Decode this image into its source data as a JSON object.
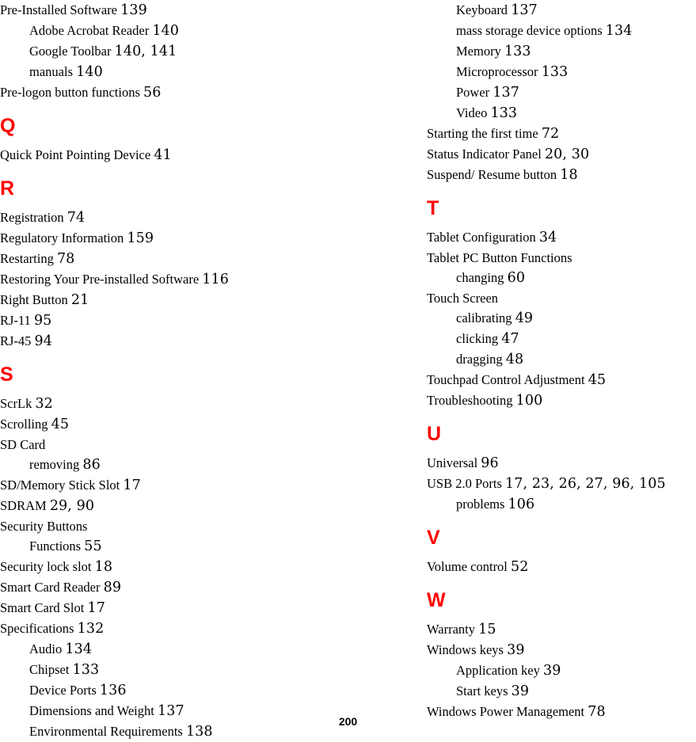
{
  "document": {
    "type": "book-index",
    "folio": "200",
    "accent_color": "#ff0000",
    "text_color": "#000000",
    "background_color": "#ffffff"
  },
  "columns": [
    {
      "name": "left-column",
      "blocks": [
        {
          "heading": null,
          "entries": [
            {
              "level": 1,
              "term": "Pre-Installed Software",
              "pages": "139"
            },
            {
              "level": 2,
              "term": "Adobe Acrobat Reader",
              "pages": "140"
            },
            {
              "level": 2,
              "term": "Google Toolbar",
              "pages": "140, 141"
            },
            {
              "level": 2,
              "term": "manuals",
              "pages": "140"
            },
            {
              "level": 1,
              "term": "Pre-logon button functions",
              "pages": "56"
            }
          ]
        },
        {
          "heading": "Q",
          "entries": [
            {
              "level": 1,
              "term": "Quick Point Pointing Device",
              "pages": "41"
            }
          ]
        },
        {
          "heading": "R",
          "entries": [
            {
              "level": 1,
              "term": "Registration",
              "pages": "74"
            },
            {
              "level": 1,
              "term": "Regulatory Information",
              "pages": "159"
            },
            {
              "level": 1,
              "term": "Restarting",
              "pages": "78"
            },
            {
              "level": 1,
              "term": "Restoring Your Pre-installed Software",
              "pages": "116"
            },
            {
              "level": 1,
              "term": "Right Button",
              "pages": "21"
            },
            {
              "level": 1,
              "term": "RJ-11",
              "pages": "95"
            },
            {
              "level": 1,
              "term": "RJ-45",
              "pages": "94"
            }
          ]
        },
        {
          "heading": "S",
          "entries": [
            {
              "level": 1,
              "term": "ScrLk",
              "pages": "32"
            },
            {
              "level": 1,
              "term": "Scrolling",
              "pages": "45"
            },
            {
              "level": 1,
              "term": "SD Card",
              "pages": ""
            },
            {
              "level": 2,
              "term": "removing",
              "pages": "86"
            },
            {
              "level": 1,
              "term": "SD/Memory Stick Slot",
              "pages": "17"
            },
            {
              "level": 1,
              "term": "SDRAM",
              "pages": "29, 90"
            },
            {
              "level": 1,
              "term": "Security Buttons",
              "pages": ""
            },
            {
              "level": 2,
              "term": "Functions",
              "pages": "55"
            },
            {
              "level": 1,
              "term": "Security lock slot",
              "pages": "18"
            },
            {
              "level": 1,
              "term": "Smart Card Reader",
              "pages": "89"
            },
            {
              "level": 1,
              "term": "Smart Card Slot",
              "pages": "17"
            },
            {
              "level": 1,
              "term": "Specifications",
              "pages": "132"
            },
            {
              "level": 2,
              "term": "Audio",
              "pages": "134"
            },
            {
              "level": 2,
              "term": "Chipset",
              "pages": "133"
            },
            {
              "level": 2,
              "term": "Device Ports",
              "pages": "136"
            },
            {
              "level": 2,
              "term": "Dimensions and Weight",
              "pages": "137"
            },
            {
              "level": 2,
              "term": "Environmental Requirements",
              "pages": "138"
            }
          ]
        }
      ]
    },
    {
      "name": "right-column",
      "blocks": [
        {
          "heading": null,
          "entries": [
            {
              "level": 2,
              "term": "Keyboard",
              "pages": "137"
            },
            {
              "level": 2,
              "term": "mass storage device options",
              "pages": "134"
            },
            {
              "level": 2,
              "term": "Memory",
              "pages": "133"
            },
            {
              "level": 2,
              "term": "Microprocessor",
              "pages": "133"
            },
            {
              "level": 2,
              "term": "Power",
              "pages": "137"
            },
            {
              "level": 2,
              "term": "Video",
              "pages": "133"
            },
            {
              "level": 1,
              "term": "Starting the first time",
              "pages": "72"
            },
            {
              "level": 1,
              "term": "Status Indicator Panel",
              "pages": "20, 30"
            },
            {
              "level": 1,
              "term": "Suspend/ Resume button",
              "pages": "18"
            }
          ]
        },
        {
          "heading": "T",
          "entries": [
            {
              "level": 1,
              "term": "Tablet Configuration",
              "pages": "34"
            },
            {
              "level": 1,
              "term": "Tablet PC Button Functions",
              "pages": ""
            },
            {
              "level": 2,
              "term": "changing",
              "pages": "60"
            },
            {
              "level": 1,
              "term": "Touch Screen",
              "pages": ""
            },
            {
              "level": 2,
              "term": "calibrating",
              "pages": "49"
            },
            {
              "level": 2,
              "term": "clicking",
              "pages": "47"
            },
            {
              "level": 2,
              "term": "dragging",
              "pages": "48"
            },
            {
              "level": 1,
              "term": "Touchpad Control Adjustment",
              "pages": "45"
            },
            {
              "level": 1,
              "term": "Troubleshooting",
              "pages": "100"
            }
          ]
        },
        {
          "heading": "U",
          "entries": [
            {
              "level": 1,
              "term": "Universal",
              "pages": "96"
            },
            {
              "level": 1,
              "term": "USB 2.0 Ports",
              "pages": "17, 23, 26, 27, 96, 105"
            },
            {
              "level": 2,
              "term": "problems",
              "pages": "106"
            }
          ]
        },
        {
          "heading": "V",
          "entries": [
            {
              "level": 1,
              "term": "Volume control",
              "pages": "52"
            }
          ]
        },
        {
          "heading": "W",
          "entries": [
            {
              "level": 1,
              "term": "Warranty",
              "pages": "15"
            },
            {
              "level": 1,
              "term": "Windows keys",
              "pages": "39"
            },
            {
              "level": 2,
              "term": "Application key",
              "pages": "39"
            },
            {
              "level": 2,
              "term": "Start keys",
              "pages": "39"
            },
            {
              "level": 1,
              "term": "Windows Power Management",
              "pages": "78"
            }
          ]
        }
      ]
    }
  ]
}
